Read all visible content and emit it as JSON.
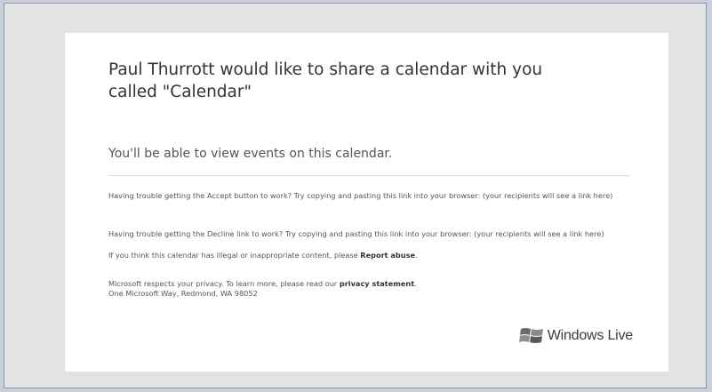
{
  "email": {
    "heading": "Paul Thurrott would like to share a calendar with you called \"Calendar\"",
    "subtext": "You'll be able to view events on this calendar.",
    "accept_help": "Having trouble getting the Accept button to work? Try copying and pasting this link into your browser: (your recipients will see a link here)",
    "decline_help": "Having trouble getting the Decline link to work? Try copying and pasting this link into your browser: (your recipients will see a link here)",
    "abuse_prefix": "If you think this calendar has illegal or inappropriate content, please ",
    "abuse_link": "Report abuse",
    "abuse_suffix": ".",
    "privacy_prefix": "Microsoft respects your privacy. To learn more, please read our ",
    "privacy_link": "privacy statement",
    "privacy_suffix": ".",
    "address": "One Microsoft Way, Redmond, WA 98052"
  },
  "brand": {
    "logo_text": "Windows Live",
    "logo_icon": "windows-flag-icon"
  }
}
